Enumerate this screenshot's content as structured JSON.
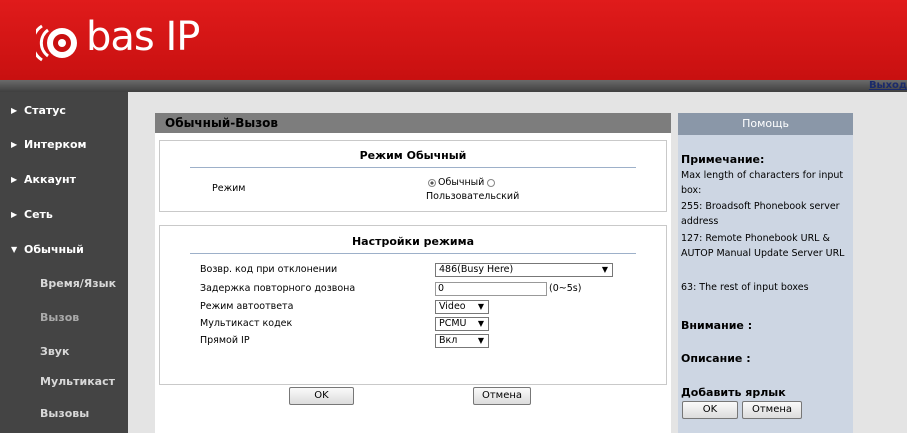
{
  "header": {
    "brand": "bas IP",
    "logout": "Выход"
  },
  "sidebar": {
    "items": [
      {
        "label": "Статус"
      },
      {
        "label": "Интерком"
      },
      {
        "label": "Аккаунт"
      },
      {
        "label": "Сеть"
      },
      {
        "label": "Обычный"
      }
    ],
    "sub_items": [
      {
        "label": "Время/Язык"
      },
      {
        "label": "Вызов"
      },
      {
        "label": "Звук"
      },
      {
        "label": "Мультикаст"
      },
      {
        "label": "Вызовы"
      }
    ]
  },
  "panel": {
    "title": "Обычный-Вызов",
    "mode_section": {
      "heading": "Режим   Обычный",
      "label": "Режим",
      "option_normal": "Обычный",
      "option_custom": "Пользовательский"
    },
    "settings_section": {
      "heading": "Настройки режима",
      "reject_code_label": "Возвр. код при отклонении",
      "reject_code_value": "486(Busy Here)",
      "redial_delay_label": "Задержка повторного дозвона",
      "redial_delay_value": "0",
      "redial_delay_hint": "(0~5s)",
      "auto_answer_label": "Режим автоответа",
      "auto_answer_value": "Video",
      "multicast_codec_label": "Мультикаст кодек",
      "multicast_codec_value": "PCMU",
      "direct_ip_label": "Прямой IP",
      "direct_ip_value": "Вкл"
    },
    "ok_label": "OK",
    "cancel_label": "Отмена"
  },
  "help": {
    "title": "Помощь",
    "note_heading": "Примечание:",
    "note_lines": [
      "Max length of characters for input box:",
      "255: Broadsoft Phonebook server address",
      "127: Remote Phonebook URL & AUTOP Manual Update Server URL",
      "63: The rest of input boxes"
    ],
    "warning_heading": "Внимание :",
    "description_heading": "Описание :",
    "shortcut_heading": "Добавить ярлык",
    "ok_label": "OK",
    "cancel_label": "Отмена"
  }
}
